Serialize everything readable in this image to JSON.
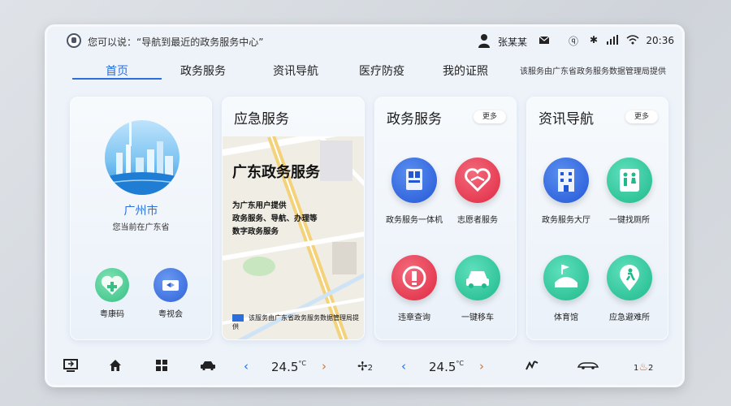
{
  "status_bar": {
    "voice_hint": "您可以说：“导航到最近的政务服务中心”",
    "user_name": "张某某",
    "time": "20:36"
  },
  "tabs": [
    {
      "label": "首页",
      "active": true
    },
    {
      "label": "政务服务",
      "active": false
    },
    {
      "label": "资讯导航",
      "active": false
    },
    {
      "label": "医疗防疫",
      "active": false
    },
    {
      "label": "我的证照",
      "active": false
    }
  ],
  "provider_note": "该服务由广东省政务服务数据管理局提供",
  "location_card": {
    "city": "广州市",
    "subtitle": "您当前在广东省",
    "apps": [
      {
        "label": "粤康码",
        "icon": "health-code-icon",
        "color": "#3cc48a"
      },
      {
        "label": "粤视会",
        "icon": "video-meeting-icon",
        "color": "#3b6fe0"
      }
    ]
  },
  "emergency_card": {
    "title": "应急服务",
    "headline": "广东政务服务",
    "desc_lines": [
      "为广东用户提供",
      "政务服务、导航、办理等",
      "数字政务服务"
    ],
    "footer": "该服务由广东省政务服务数据管理局提供"
  },
  "gov_card": {
    "title": "政务服务",
    "more": "更多",
    "apps": [
      {
        "label": "政务服务一体机",
        "icon": "service-kiosk-icon",
        "color": "#2f6fe4"
      },
      {
        "label": "志愿者服务",
        "icon": "volunteer-heart-icon",
        "color": "#e8344a"
      },
      {
        "label": "违章查询",
        "icon": "violation-query-icon",
        "color": "#e8344a"
      },
      {
        "label": "一键移车",
        "icon": "move-car-icon",
        "color": "#27c39a"
      }
    ]
  },
  "info_card": {
    "title": "资讯导航",
    "more": "更多",
    "apps": [
      {
        "label": "政务服务大厅",
        "icon": "service-hall-icon",
        "color": "#2f6fe4"
      },
      {
        "label": "一键找厕所",
        "icon": "restroom-icon",
        "color": "#27c39a"
      },
      {
        "label": "体育馆",
        "icon": "stadium-icon",
        "color": "#27c39a"
      },
      {
        "label": "应急避难所",
        "icon": "shelter-icon",
        "color": "#27c39a"
      }
    ]
  },
  "bottom_bar": {
    "temp_left": "24.5",
    "temp_right": "24.5",
    "temp_unit": "°C",
    "fan_level": "2",
    "seat_left": "1",
    "seat_right": "2"
  }
}
